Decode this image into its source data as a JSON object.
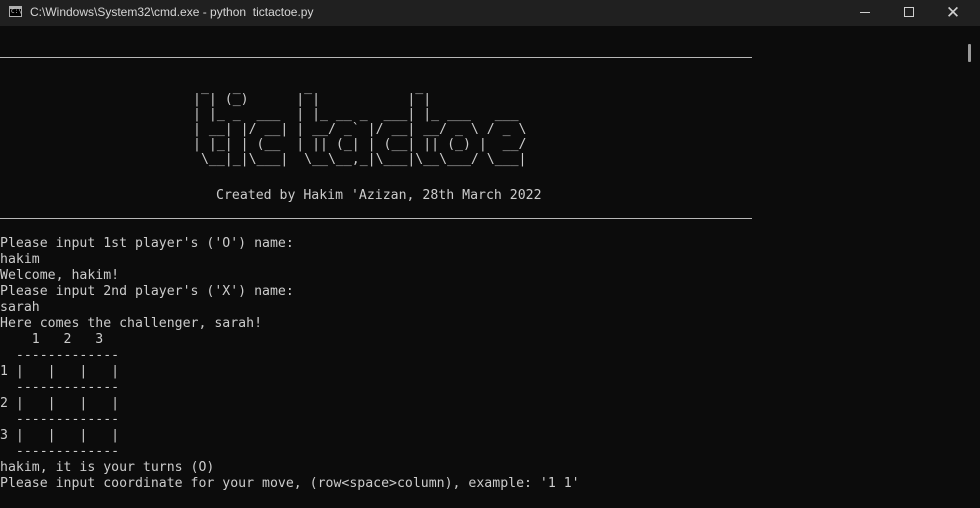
{
  "window": {
    "title": "C:\\Windows\\System32\\cmd.exe - python  tictactoe.py",
    "minimize_glyph": "─",
    "maximize_glyph": "☐",
    "close_glyph": "✕",
    "icon": "console-icon",
    "icon_prompt": "C:\\"
  },
  "banner": {
    "art": [
      " _   _        _             _",
      "| | (_)      | |           | |",
      "| |_ _  ___  | |_ __ _  ___| |_ ___   ___",
      "| __| |/ __| | __/ _` |/ __| __/ _ \\ / _ \\",
      "| |_| | (__  | || (_| | (__| || (_) |  __/",
      " \\__|_|\\___|  \\__\\__,_|\\___|\\__\\___/ \\___|"
    ],
    "credit": "Created by Hakim 'Azizan, 28th March 2022"
  },
  "console": {
    "lines": [
      "Please input 1st player's ('O') name:",
      "hakim",
      "Welcome, hakim!",
      "Please input 2nd player's ('X') name:",
      "sarah",
      "Here comes the challenger, sarah!",
      "    1   2   3",
      "  -------------",
      "1 |   |   |   |",
      "  -------------",
      "2 |   |   |   |",
      "  -------------",
      "3 |   |   |   |",
      "  -------------",
      "hakim, it is your turns (O)",
      "Please input coordinate for your move, (row<space>column), example: '1 1'"
    ]
  }
}
